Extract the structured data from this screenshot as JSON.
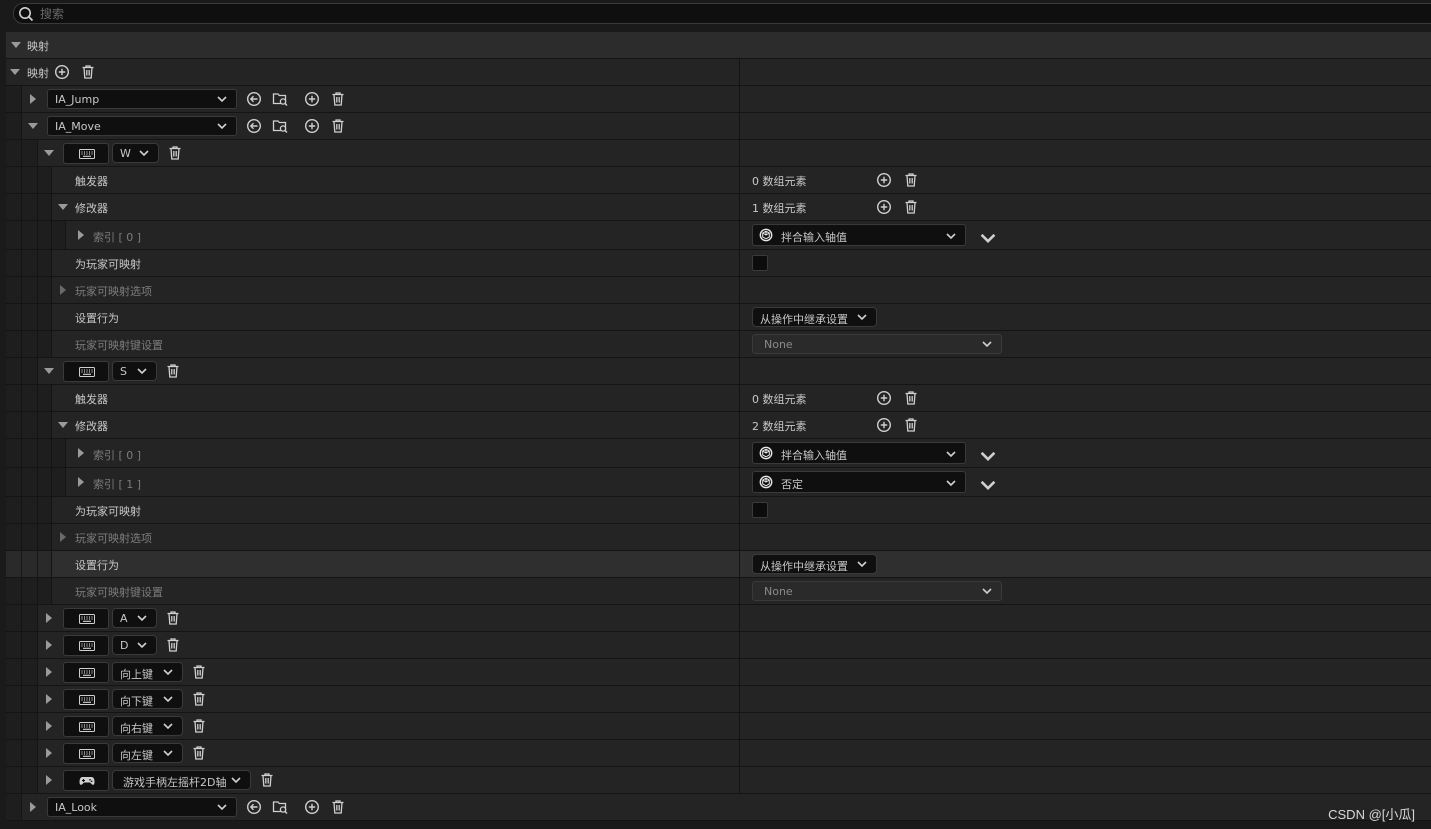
{
  "search": {
    "placeholder": "搜索"
  },
  "section": {
    "title": "映射"
  },
  "mappings": {
    "label": "映射",
    "actions": [
      {
        "name": "IA_Jump"
      },
      {
        "name": "IA_Move",
        "keys": [
          {
            "key": "W",
            "triggers_label": "触发器",
            "triggers_value": "0 数组元素",
            "modifiers_label": "修改器",
            "modifiers_value": "1 数组元素",
            "modifier_items": [
              {
                "index": "索引 [ 0 ]",
                "value": "拌合输入轴值"
              }
            ],
            "player_mappable_label": "为玩家可映射",
            "player_mappable_options": "玩家可映射选项",
            "set_behavior_label": "设置行为",
            "set_behavior_value": "从操作中继承设置",
            "player_key_settings": "玩家可映射键设置",
            "player_key_settings_value": "None"
          },
          {
            "key": "S",
            "triggers_label": "触发器",
            "triggers_value": "0 数组元素",
            "modifiers_label": "修改器",
            "modifiers_value": "2 数组元素",
            "modifier_items": [
              {
                "index": "索引 [ 0 ]",
                "value": "拌合输入轴值"
              },
              {
                "index": "索引 [ 1 ]",
                "value": "否定"
              }
            ],
            "player_mappable_label": "为玩家可映射",
            "player_mappable_options": "玩家可映射选项",
            "set_behavior_label": "设置行为",
            "set_behavior_value": "从操作中继承设置",
            "player_key_settings": "玩家可映射键设置",
            "player_key_settings_value": "None"
          }
        ],
        "collapsed_keys": [
          {
            "key": "A",
            "device": "keyboard-icon"
          },
          {
            "key": "D",
            "device": "keyboard-icon"
          },
          {
            "key": "向上键",
            "device": "keyboard-icon"
          },
          {
            "key": "向下键",
            "device": "keyboard-icon"
          },
          {
            "key": "向右键",
            "device": "keyboard-icon"
          },
          {
            "key": "向左键",
            "device": "keyboard-icon"
          },
          {
            "key": "游戏手柄左摇杆2D轴",
            "device": "gamepad-icon"
          }
        ]
      },
      {
        "name": "IA_Look"
      }
    ]
  },
  "watermark": "CSDN @[小瓜]",
  "colors": {
    "background": "#1a1a1a",
    "row": "#242424",
    "header": "#2c2c2c",
    "field": "#0f0f0f",
    "text": "#c8c8c8",
    "dim_text": "#7c7c7c"
  }
}
